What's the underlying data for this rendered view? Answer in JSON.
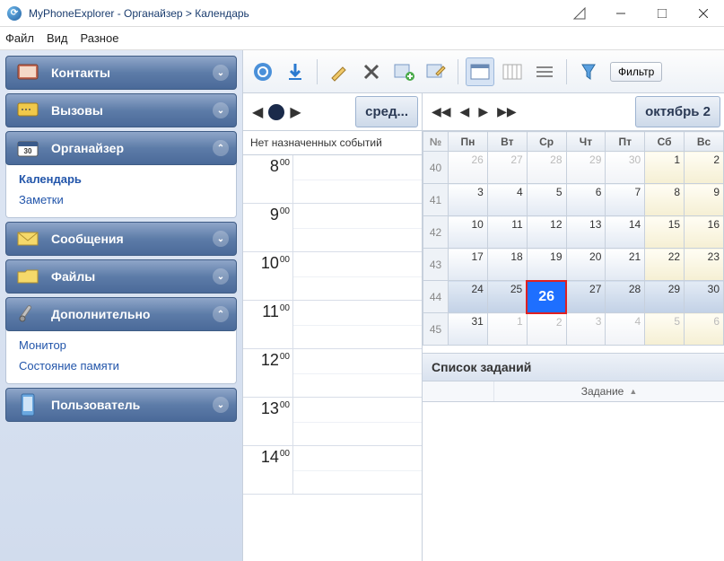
{
  "title": "MyPhoneExplorer -  Органайзер > Календарь",
  "menu": {
    "file": "Файл",
    "view": "Вид",
    "misc": "Разное"
  },
  "sidebar": {
    "contacts": "Контакты",
    "calls": "Вызовы",
    "organizer": "Органайзер",
    "organizer_items": {
      "calendar": "Календарь",
      "notes": "Заметки"
    },
    "messages": "Сообщения",
    "files": "Файлы",
    "advanced": "Дополнительно",
    "advanced_items": {
      "monitor": "Монитор",
      "memory": "Состояние памяти"
    },
    "user": "Пользователь"
  },
  "toolbar": {
    "filter": "Фильтр"
  },
  "day": {
    "label": "сред...",
    "no_events": "Нет назначенных событий",
    "hours": [
      "8",
      "9",
      "10",
      "11",
      "12",
      "13",
      "14"
    ]
  },
  "month": {
    "label": "октябрь 2",
    "wk_header": "№",
    "dow": [
      "Пн",
      "Вт",
      "Ср",
      "Чт",
      "Пт",
      "Сб",
      "Вс"
    ],
    "weeks": [
      {
        "n": "40",
        "d": [
          {
            "v": "26",
            "o": true
          },
          {
            "v": "27",
            "o": true
          },
          {
            "v": "28",
            "o": true
          },
          {
            "v": "29",
            "o": true
          },
          {
            "v": "30",
            "o": true
          },
          {
            "v": "1",
            "w": true
          },
          {
            "v": "2",
            "w": true
          }
        ]
      },
      {
        "n": "41",
        "d": [
          {
            "v": "3"
          },
          {
            "v": "4"
          },
          {
            "v": "5"
          },
          {
            "v": "6"
          },
          {
            "v": "7"
          },
          {
            "v": "8",
            "w": true
          },
          {
            "v": "9",
            "w": true
          }
        ]
      },
      {
        "n": "42",
        "d": [
          {
            "v": "10"
          },
          {
            "v": "11"
          },
          {
            "v": "12"
          },
          {
            "v": "13"
          },
          {
            "v": "14"
          },
          {
            "v": "15",
            "w": true
          },
          {
            "v": "16",
            "w": true
          }
        ]
      },
      {
        "n": "43",
        "d": [
          {
            "v": "17"
          },
          {
            "v": "18"
          },
          {
            "v": "19"
          },
          {
            "v": "20"
          },
          {
            "v": "21"
          },
          {
            "v": "22",
            "w": true
          },
          {
            "v": "23",
            "w": true
          }
        ]
      },
      {
        "n": "44",
        "d": [
          {
            "v": "24",
            "s": true
          },
          {
            "v": "25",
            "s": true
          },
          {
            "v": "26",
            "t": true
          },
          {
            "v": "27",
            "s": true
          },
          {
            "v": "28",
            "s": true
          },
          {
            "v": "29",
            "w": true,
            "s": true
          },
          {
            "v": "30",
            "w": true,
            "s": true
          }
        ]
      },
      {
        "n": "45",
        "d": [
          {
            "v": "31"
          },
          {
            "v": "1",
            "o": true
          },
          {
            "v": "2",
            "o": true
          },
          {
            "v": "3",
            "o": true
          },
          {
            "v": "4",
            "o": true
          },
          {
            "v": "5",
            "o": true,
            "w": true
          },
          {
            "v": "6",
            "o": true,
            "w": true
          }
        ]
      }
    ]
  },
  "tasks": {
    "title": "Список заданий",
    "col": "Задание"
  }
}
